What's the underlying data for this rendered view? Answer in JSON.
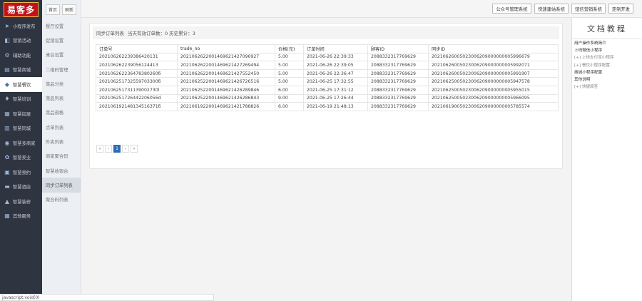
{
  "logo": {
    "text": "易客多"
  },
  "left_nav": [
    {
      "label": "小程序发布",
      "icon": "send-icon"
    },
    {
      "label": "营销活动",
      "icon": "megaphone-icon"
    },
    {
      "label": "辅助功能",
      "icon": "tools-icon"
    },
    {
      "label": "智慧商城",
      "icon": "store-icon"
    },
    {
      "label": "智慧餐饮",
      "icon": "dining-icon",
      "active": true
    },
    {
      "label": "智慧培训",
      "icon": "training-icon"
    },
    {
      "label": "智慧房屋",
      "icon": "house-icon"
    },
    {
      "label": "智慧同城",
      "icon": "city-icon"
    },
    {
      "label": "智慧多商家",
      "icon": "merchants-icon"
    },
    {
      "label": "智慧美业",
      "icon": "beauty-icon"
    },
    {
      "label": "智慧预约",
      "icon": "calendar-icon"
    },
    {
      "label": "智慧酒店",
      "icon": "hotel-icon"
    },
    {
      "label": "智慧装修",
      "icon": "decor-icon"
    },
    {
      "label": "其他服务",
      "icon": "grid-icon"
    }
  ],
  "toolbar": {
    "home_label": "首页",
    "refresh_label": "刷新"
  },
  "sub_nav": [
    {
      "label": "餐厅设置"
    },
    {
      "label": "促销设置"
    },
    {
      "label": "桌台设置"
    },
    {
      "label": "二维码管理"
    },
    {
      "label": "菜品分类"
    },
    {
      "label": "菜品列表"
    },
    {
      "label": "菜品规格"
    },
    {
      "label": "点单列表"
    },
    {
      "label": "外卖列表"
    },
    {
      "label": "商家聚合码"
    },
    {
      "label": "智慧收银台"
    },
    {
      "label": "同步订单列表",
      "active": true
    },
    {
      "label": "聚合码列表"
    }
  ],
  "top_buttons": [
    {
      "label": "公众号管理系统"
    },
    {
      "label": "快速建站系统"
    },
    {
      "label": "短信营销系统"
    },
    {
      "label": "定制开发"
    }
  ],
  "main": {
    "heading": "同步订单列表",
    "summary": "当天有效订单数：0 历史累计：3",
    "columns": [
      "订单号",
      "trade_no",
      "价格(元)",
      "订单时间",
      "顾客ID",
      "同步ID"
    ],
    "rows": [
      [
        "202106262239386420131",
        "2021062622001469621427096927",
        "5.00",
        "2021-06-26 22:39:33",
        "2088332317769629",
        "20210626005023006209000000005996679"
      ],
      [
        "202106262239056124413",
        "2021062622001469621427269494",
        "5.00",
        "2021-06-26 22:39:05",
        "2088332317769629",
        "20210626005023006209000000005992071"
      ],
      [
        "202106262236478380260б",
        "2021062622001469621427552450",
        "5.00",
        "2021-06-26 22:36:47",
        "2088332317769629",
        "20210626005023006209000000005991907"
      ],
      [
        "202106251732559703300б",
        "2021062522001469621426726516",
        "5.00",
        "2021-06-25 17:32:55",
        "2088332317769629",
        "20210625005023006209000000005947578"
      ],
      [
        "202106251731139002730l",
        "2021062522001469621426289846",
        "6.00",
        "2021-06-25 17:31:12",
        "2088332317769629",
        "20210625005023006209000000005955015"
      ],
      [
        "202106251726442206056d",
        "2021062522001469621426286843",
        "9.00",
        "2021-06-25 17:26:44",
        "2088332317769629",
        "20210625005023006209000000005966095"
      ],
      [
        "202106192148134516371б",
        "2021061922001469621421788826",
        "6.00",
        "2021-06-19 21:48:13",
        "2088332317769629",
        "20210619005023006209000000005785574"
      ]
    ],
    "pager": {
      "first": "«",
      "prev": "‹",
      "current": "1",
      "next": "›",
      "last": "»"
    }
  },
  "doc": {
    "title": "文档教程",
    "links": [
      {
        "label": "用户操作系统简介",
        "sub": false
      },
      {
        "label": "上线微信小程序",
        "sub": false
      },
      {
        "label": "[+] 上线支付宝小程序",
        "sub": true
      },
      {
        "label": "[+] 餐饮小程序配置",
        "sub": true
      },
      {
        "label": "商城小程序配置",
        "sub": false
      },
      {
        "label": "其他说明",
        "sub": false
      },
      {
        "label": "[+] 快捷简答",
        "sub": true
      }
    ]
  },
  "status_bar": {
    "url": "javascript:void(0)"
  }
}
